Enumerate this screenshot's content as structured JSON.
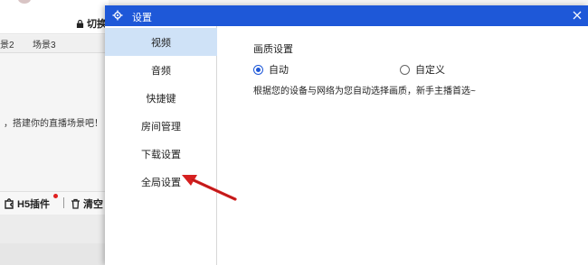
{
  "background_app": {
    "switch_label": "切换",
    "scene_tab_prev": "景2",
    "scene_tab": "场景3",
    "hint_text": "，搭建你的直播场景吧！",
    "h5_plugin_label": "H5插件",
    "clear_label": "清空"
  },
  "dialog": {
    "title": "设置",
    "nav_items": [
      {
        "label": "视频",
        "active": true
      },
      {
        "label": "音频",
        "active": false
      },
      {
        "label": "快捷键",
        "active": false
      },
      {
        "label": "房间管理",
        "active": false
      },
      {
        "label": "下载设置",
        "active": false
      },
      {
        "label": "全局设置",
        "active": false
      }
    ],
    "video": {
      "section_title": "画质设置",
      "options": [
        {
          "label": "自动",
          "checked": true
        },
        {
          "label": "自定义",
          "checked": false
        }
      ],
      "description": "根据您的设备与网络为您自动选择画质，新手主播首选~"
    }
  },
  "colors": {
    "titlebar": "#1e58d8",
    "nav_active_bg": "#cfe2f7",
    "annotation_arrow": "#d62020"
  }
}
